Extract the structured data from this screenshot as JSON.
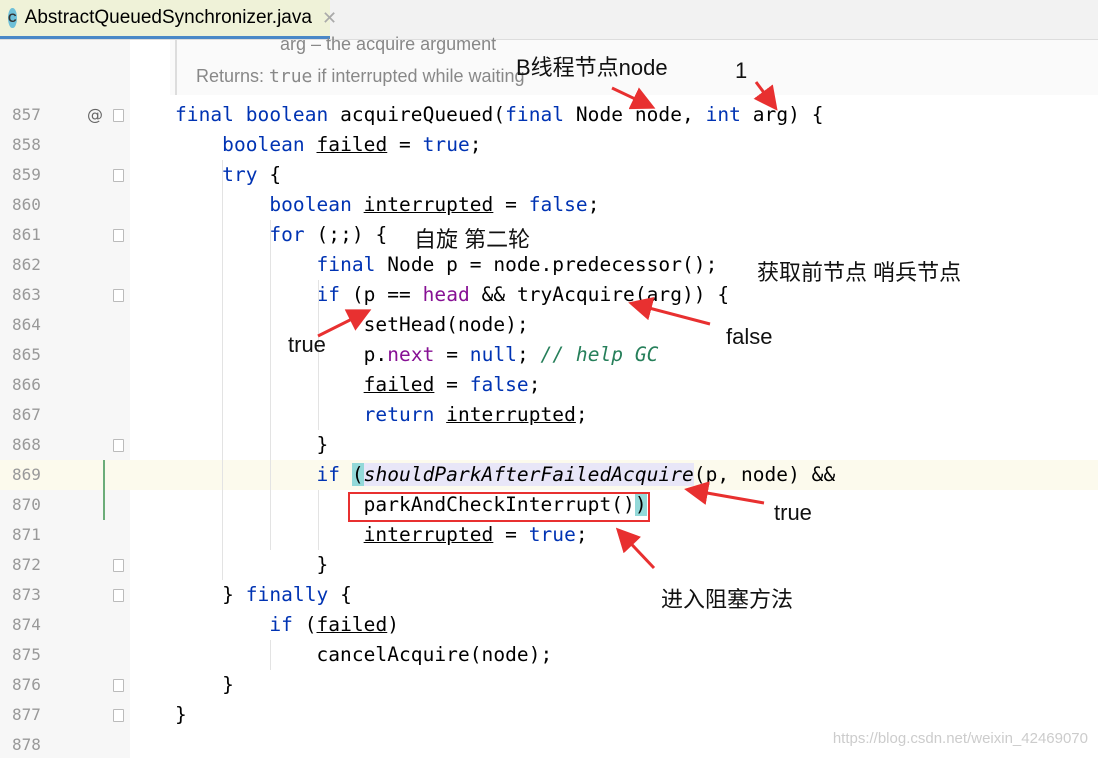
{
  "tab": {
    "title": "AbstractQueuedSynchronizer.java",
    "icon": "java-class-icon",
    "close": "✕"
  },
  "doc": {
    "param": "arg – the acquire argument",
    "returns_label": "Returns:",
    "returns_code": "true",
    "returns_text": " if interrupted while waiting"
  },
  "gutter_mark": "@",
  "colors": {
    "keyword": "#0033b3",
    "field": "#871094",
    "comment": "#267f5a",
    "annotation_arrow": "#e83030",
    "box": "#e83030"
  },
  "lines": [
    {
      "n": "857",
      "tokens": [
        [
          "kw",
          "final boolean "
        ],
        [
          "",
          "acquireQueued("
        ],
        [
          "kw",
          "final "
        ],
        [
          "",
          "Node node, "
        ],
        [
          "kw",
          "int "
        ],
        [
          "",
          "arg) {"
        ]
      ]
    },
    {
      "n": "858",
      "tokens": [
        [
          "",
          "    "
        ],
        [
          "kw",
          "boolean "
        ],
        [
          "ul",
          "failed"
        ],
        [
          "",
          " = "
        ],
        [
          "kw",
          "true"
        ],
        [
          "",
          ";"
        ]
      ]
    },
    {
      "n": "859",
      "tokens": [
        [
          "",
          "    "
        ],
        [
          "kw",
          "try "
        ],
        [
          "",
          "{"
        ]
      ]
    },
    {
      "n": "860",
      "tokens": [
        [
          "",
          "        "
        ],
        [
          "kw",
          "boolean "
        ],
        [
          "ul",
          "interrupted"
        ],
        [
          "",
          " = "
        ],
        [
          "kw",
          "false"
        ],
        [
          "",
          ";"
        ]
      ]
    },
    {
      "n": "861",
      "tokens": [
        [
          "",
          "        "
        ],
        [
          "kw",
          "for "
        ],
        [
          "",
          "(;;) {"
        ]
      ]
    },
    {
      "n": "862",
      "tokens": [
        [
          "",
          "            "
        ],
        [
          "kw",
          "final "
        ],
        [
          "",
          "Node p = node.predecessor();"
        ]
      ]
    },
    {
      "n": "863",
      "tokens": [
        [
          "",
          "            "
        ],
        [
          "kw",
          "if "
        ],
        [
          "",
          "(p == "
        ],
        [
          "fd",
          "head"
        ],
        [
          "",
          " && tryAcquire(arg)) {"
        ]
      ]
    },
    {
      "n": "864",
      "tokens": [
        [
          "",
          "                setHead(node);"
        ]
      ]
    },
    {
      "n": "865",
      "tokens": [
        [
          "",
          "                p."
        ],
        [
          "fd",
          "next"
        ],
        [
          "",
          " = "
        ],
        [
          "kw",
          "null"
        ],
        [
          "",
          "; "
        ],
        [
          "cm",
          "// help GC"
        ]
      ]
    },
    {
      "n": "866",
      "tokens": [
        [
          "",
          "                "
        ],
        [
          "ul",
          "failed"
        ],
        [
          "",
          " = "
        ],
        [
          "kw",
          "false"
        ],
        [
          "",
          ";"
        ]
      ]
    },
    {
      "n": "867",
      "tokens": [
        [
          "",
          "                "
        ],
        [
          "kw",
          "return "
        ],
        [
          "ul",
          "interrupted"
        ],
        [
          "",
          ";"
        ]
      ]
    },
    {
      "n": "868",
      "tokens": [
        [
          "",
          "            }"
        ]
      ]
    },
    {
      "n": "869",
      "tokens": [
        [
          "",
          "            "
        ],
        [
          "kw",
          "if "
        ],
        [
          "br",
          "("
        ],
        [
          "hl it",
          "shouldParkAfterFailedAcquire"
        ],
        [
          "",
          "(p, node) &&"
        ]
      ]
    },
    {
      "n": "870",
      "tokens": [
        [
          "",
          "                parkAndCheckInterrupt()"
        ],
        [
          "br",
          ")"
        ]
      ]
    },
    {
      "n": "871",
      "tokens": [
        [
          "",
          "                "
        ],
        [
          "ul",
          "interrupted"
        ],
        [
          "",
          " = "
        ],
        [
          "kw",
          "true"
        ],
        [
          "",
          ";"
        ]
      ]
    },
    {
      "n": "872",
      "tokens": [
        [
          "",
          "            }"
        ]
      ]
    },
    {
      "n": "873",
      "tokens": [
        [
          "",
          "    } "
        ],
        [
          "kw",
          "finally "
        ],
        [
          "",
          "{"
        ]
      ]
    },
    {
      "n": "874",
      "tokens": [
        [
          "",
          "        "
        ],
        [
          "kw",
          "if "
        ],
        [
          "",
          "("
        ],
        [
          "ul",
          "failed"
        ],
        [
          "",
          ")"
        ]
      ]
    },
    {
      "n": "875",
      "tokens": [
        [
          "",
          "            cancelAcquire(node);"
        ]
      ]
    },
    {
      "n": "876",
      "tokens": [
        [
          "",
          "    }"
        ]
      ]
    },
    {
      "n": "877",
      "tokens": [
        [
          "",
          "}"
        ]
      ]
    },
    {
      "n": "878",
      "tokens": []
    }
  ],
  "annotations": {
    "b_node": "B线程节点node",
    "one": "1",
    "spin": "自旋 第二轮",
    "pred": "获取前节点 哨兵节点",
    "true1": "true",
    "false1": "false",
    "true2": "true",
    "block": "进入阻塞方法"
  },
  "watermark": "https://blog.csdn.net/weixin_42469070"
}
